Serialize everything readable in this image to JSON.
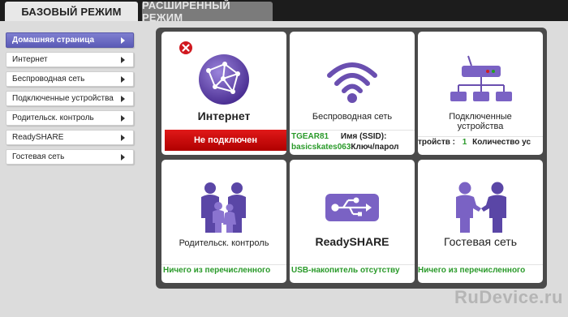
{
  "tabs": {
    "basic": "БАЗОВЫЙ РЕЖИМ",
    "advanced": "РАСШИРЕННЫЙ РЕЖИМ"
  },
  "sidebar": {
    "items": [
      {
        "label": "Домашняя страница"
      },
      {
        "label": "Интернет"
      },
      {
        "label": "Беспроводная сеть"
      },
      {
        "label": "Подключенные устройства"
      },
      {
        "label": "Родительск. контроль"
      },
      {
        "label": "ReadySHARE"
      },
      {
        "label": "Гостевая сеть"
      }
    ]
  },
  "tiles": {
    "internet": {
      "title": "Интернет",
      "status": "Не подключен"
    },
    "wireless": {
      "title": "Беспроводная сеть",
      "ssid_value": "TGEAR81",
      "ssid_label": "Имя (SSID):",
      "password_value": "basicskates063",
      "password_label": "Ключ/парол"
    },
    "devices": {
      "title": "Подключенные устройства",
      "status_prefix": "тройств :",
      "status_count": "1",
      "status_suffix": "Количество ус"
    },
    "parental": {
      "title": "Родительск. контроль",
      "status": "Ничего из перечисленного"
    },
    "readyshare": {
      "title": "ReadySHARE",
      "status": "USB-накопитель отсутству"
    },
    "guest": {
      "title": "Гостевая сеть",
      "status": "Ничего из перечисленного"
    }
  },
  "watermark": "RuDevice.ru",
  "colors": {
    "accent_purple": "#5b5bb7",
    "status_green": "#2a9a2a",
    "alert_red": "#d00000",
    "icon_purple": "#6a4fb0"
  }
}
